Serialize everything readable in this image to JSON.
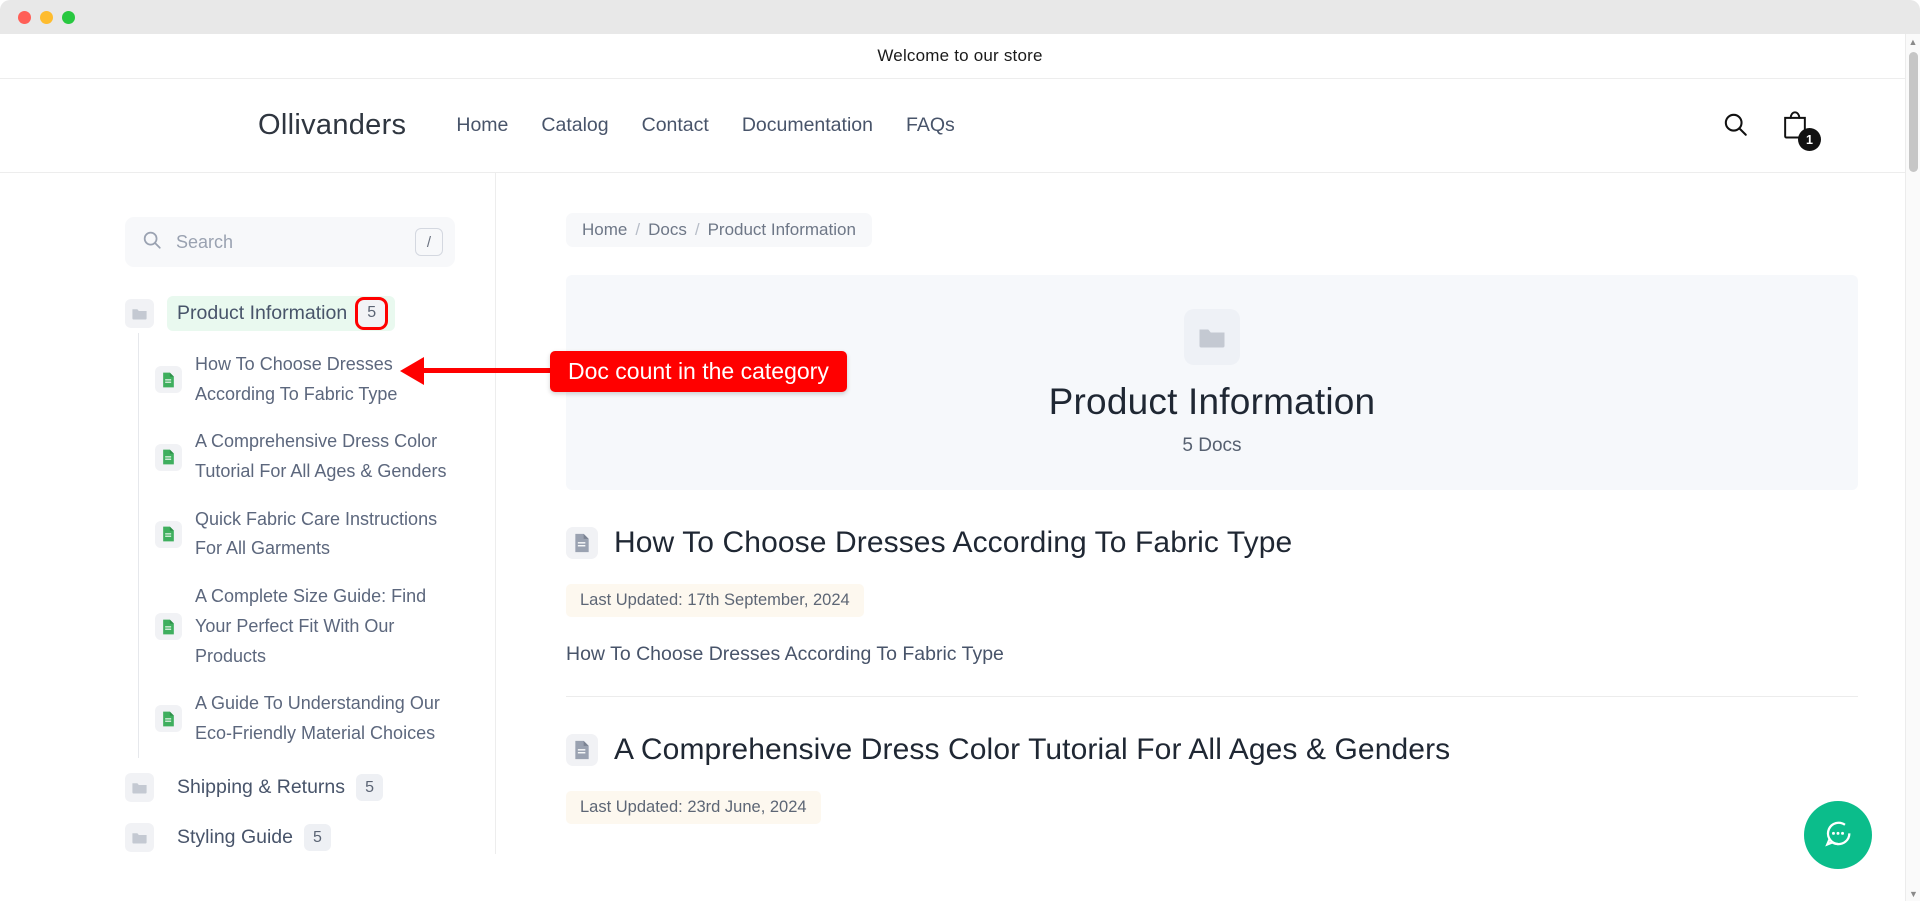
{
  "window": {
    "traffic_lights": [
      "close",
      "minimize",
      "zoom"
    ]
  },
  "announcement": {
    "text": "Welcome to our store"
  },
  "header": {
    "brand": "Ollivanders",
    "nav": [
      {
        "label": "Home",
        "name": "nav-home"
      },
      {
        "label": "Catalog",
        "name": "nav-catalog"
      },
      {
        "label": "Contact",
        "name": "nav-contact"
      },
      {
        "label": "Documentation",
        "name": "nav-documentation"
      },
      {
        "label": "FAQs",
        "name": "nav-faqs"
      }
    ],
    "search_icon": "search-icon",
    "cart_icon": "shopping-bag-icon",
    "cart_count": "1"
  },
  "sidebar": {
    "search": {
      "placeholder": "Search",
      "icon": "search-icon",
      "shortcut_key": "/"
    },
    "categories": [
      {
        "label": "Product Information",
        "count": "5",
        "active": true,
        "icon": "folder-icon",
        "docs": [
          {
            "title": "How To Choose Dresses According To Fabric Type",
            "icon": "document-icon"
          },
          {
            "title": "A Comprehensive Dress Color Tutorial For All Ages & Genders",
            "icon": "document-icon"
          },
          {
            "title": "Quick Fabric Care Instructions For All Garments",
            "icon": "document-icon"
          },
          {
            "title": "A Complete Size Guide: Find Your Perfect Fit With Our Products",
            "icon": "document-icon"
          },
          {
            "title": "A Guide To Understanding Our Eco-Friendly Material Choices",
            "icon": "document-icon"
          }
        ]
      },
      {
        "label": "Shipping & Returns",
        "count": "5",
        "active": false,
        "icon": "folder-icon",
        "docs": []
      },
      {
        "label": "Styling Guide",
        "count": "5",
        "active": false,
        "icon": "folder-icon",
        "docs": []
      }
    ]
  },
  "main": {
    "breadcrumb": {
      "items": [
        "Home",
        "Docs",
        "Product Information"
      ],
      "separator": "/"
    },
    "hero": {
      "icon": "folder-icon",
      "title": "Product Information",
      "subtitle": "5 Docs"
    },
    "doc_entries": [
      {
        "icon": "document-icon",
        "title": "How To Choose Dresses According To Fabric Type",
        "updated": "Last Updated: 17th September, 2024",
        "excerpt": "How To Choose Dresses According To Fabric Type"
      },
      {
        "icon": "document-icon",
        "title": "A Comprehensive Dress Color Tutorial For All Ages & Genders",
        "updated": "Last Updated: 23rd June, 2024",
        "excerpt": ""
      }
    ]
  },
  "annotation": {
    "label": "Doc count in the category",
    "color": "#ff0000"
  },
  "chat_widget": {
    "icon": "chat-bubble-icon",
    "color": "#0bbd8b"
  },
  "colors": {
    "accent_green": "#0bbd8b",
    "active_highlight": "#e9f9ef",
    "annotation_red": "#ff0000",
    "doc_icon_green": "#3faf5e",
    "hero_bg": "#f6f8fb",
    "updated_pill_bg": "#fdf8ef"
  }
}
